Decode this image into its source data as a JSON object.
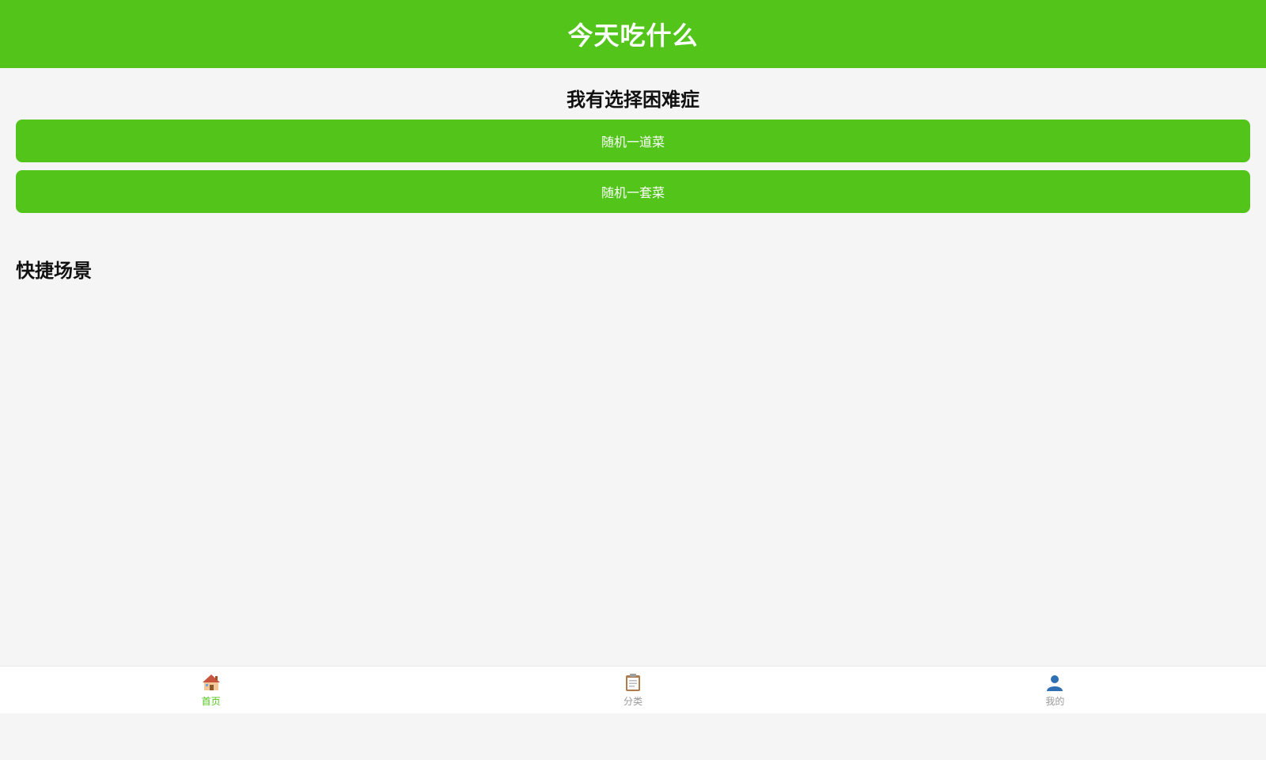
{
  "colors": {
    "primary": "#52c41a",
    "background": "#f5f5f5",
    "tabbar_bg": "#ffffff",
    "inactive_label": "#999999"
  },
  "header": {
    "title": "今天吃什么"
  },
  "decision": {
    "title": "我有选择困难症",
    "random_dish_label": "随机一道菜",
    "random_set_label": "随机一套菜"
  },
  "scenes": {
    "title": "快捷场景"
  },
  "tabbar": {
    "items": [
      {
        "label": "首页",
        "icon": "home-icon",
        "active": true
      },
      {
        "label": "分类",
        "icon": "clipboard-icon",
        "active": false
      },
      {
        "label": "我的",
        "icon": "user-icon",
        "active": false
      }
    ]
  }
}
